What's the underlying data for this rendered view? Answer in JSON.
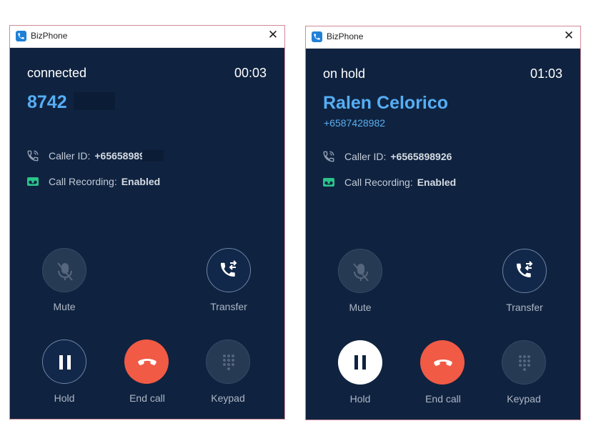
{
  "colors": {
    "window_bg": "#0f2340",
    "accent_blue": "#56aef5",
    "end_call_red": "#f15a45",
    "recording_green": "#2bc48a"
  },
  "windows": [
    {
      "title": "BizPhone",
      "status": "connected",
      "timer": "00:03",
      "callee_name": "8742",
      "callee_number": "",
      "caller_id_label": "Caller ID:",
      "caller_id_value": "+65658989",
      "recording_label": "Call Recording:",
      "recording_value": "Enabled",
      "buttons": {
        "mute": "Mute",
        "transfer": "Transfer",
        "hold": "Hold",
        "end_call": "End call",
        "keypad": "Keypad"
      },
      "hold_active": false
    },
    {
      "title": "BizPhone",
      "status": "on hold",
      "timer": "01:03",
      "callee_name": "Ralen Celorico",
      "callee_number": "+6587428982",
      "caller_id_label": "Caller ID:",
      "caller_id_value": "+6565898926",
      "recording_label": "Call Recording:",
      "recording_value": "Enabled",
      "buttons": {
        "mute": "Mute",
        "transfer": "Transfer",
        "hold": "Hold",
        "end_call": "End call",
        "keypad": "Keypad"
      },
      "hold_active": true
    }
  ]
}
